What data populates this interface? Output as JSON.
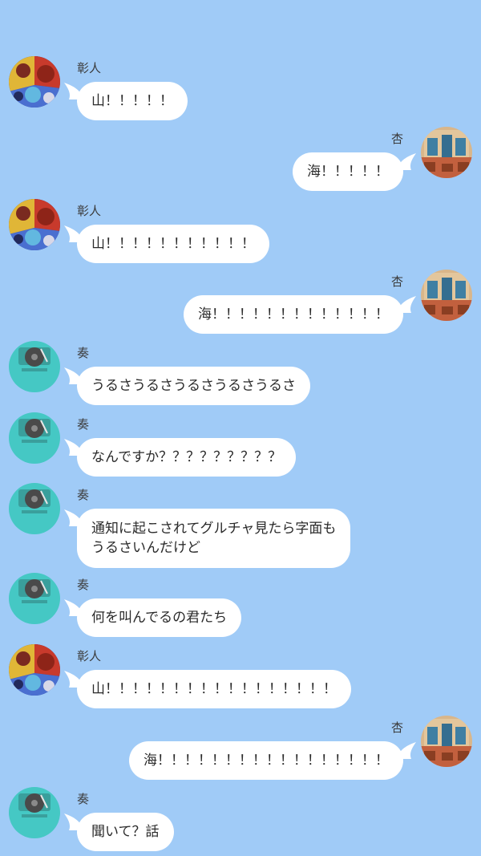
{
  "messages": [
    {
      "side": "left",
      "avatar": "akito-avatar",
      "name": "彰人",
      "text": "山！！！！！"
    },
    {
      "side": "right",
      "avatar": "an-avatar",
      "name": "杏",
      "text": "海！！！！！"
    },
    {
      "side": "left",
      "avatar": "akito-avatar",
      "name": "彰人",
      "text": "山！！！！！！！！！！！"
    },
    {
      "side": "right",
      "avatar": "an-avatar",
      "name": "杏",
      "text": "海！！！！！！！！！！！！！"
    },
    {
      "side": "left",
      "avatar": "kanade-avatar",
      "name": "奏",
      "text": "うるさうるさうるさうるさうるさ"
    },
    {
      "side": "left",
      "avatar": "kanade-avatar",
      "name": "奏",
      "text": "なんですか？？？？？？？？？"
    },
    {
      "side": "left",
      "avatar": "kanade-avatar",
      "name": "奏",
      "text": "通知に起こされてグルチャ見たら字面も\nうるさいんだけど"
    },
    {
      "side": "left",
      "avatar": "kanade-avatar",
      "name": "奏",
      "text": "何を叫んでるの君たち"
    },
    {
      "side": "left",
      "avatar": "akito-avatar",
      "name": "彰人",
      "text": "山！！！！！！！！！！！！！！！！！"
    },
    {
      "side": "right",
      "avatar": "an-avatar",
      "name": "杏",
      "text": "海！！！！！！！！！！！！！！！！！"
    },
    {
      "side": "left",
      "avatar": "kanade-avatar",
      "name": "奏",
      "text": "聞いて？話"
    }
  ],
  "colors": {
    "background": "#a0cbf7",
    "bubble": "#ffffff",
    "kanade_avatar": "#45c8c4"
  }
}
